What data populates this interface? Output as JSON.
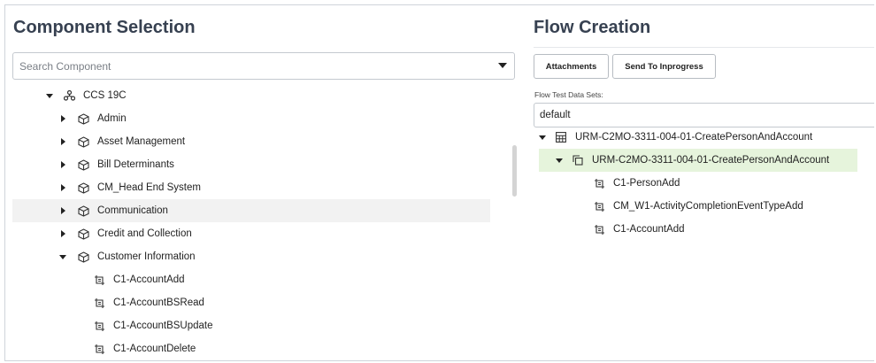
{
  "component_selection": {
    "title": "Component Selection",
    "search_placeholder": "Search Component",
    "tree": {
      "root": "CCS 19C",
      "groups": [
        "Admin",
        "Asset Management",
        "Bill Determinants",
        "CM_Head End System",
        "Communication",
        "Credit and Collection",
        "Customer Information"
      ],
      "customer_information_items": [
        "C1-AccountAdd",
        "C1-AccountBSRead",
        "C1-AccountBSUpdate",
        "C1-AccountDelete"
      ]
    }
  },
  "flow_creation": {
    "title": "Flow Creation",
    "attachments_label": "Attachments",
    "send_label": "Send To Inprogress",
    "data_sets_label": "Flow Test Data Sets:",
    "data_set_value": "default",
    "flow": {
      "root": "URM-C2MO-3311-004-01-CreatePersonAndAccount",
      "child": "URM-C2MO-3311-004-01-CreatePersonAndAccount",
      "steps": [
        "C1-PersonAdd",
        "CM_W1-ActivityCompletionEventTypeAdd",
        "C1-AccountAdd"
      ]
    }
  },
  "icons": {
    "root": "network-icon",
    "group": "cube-icon",
    "component": "component-icon",
    "flow_root": "grid-icon",
    "flow_child": "copy-icon"
  },
  "colors": {
    "selected_row": "#e6f4dc",
    "hover_row": "#f2f2f2"
  }
}
